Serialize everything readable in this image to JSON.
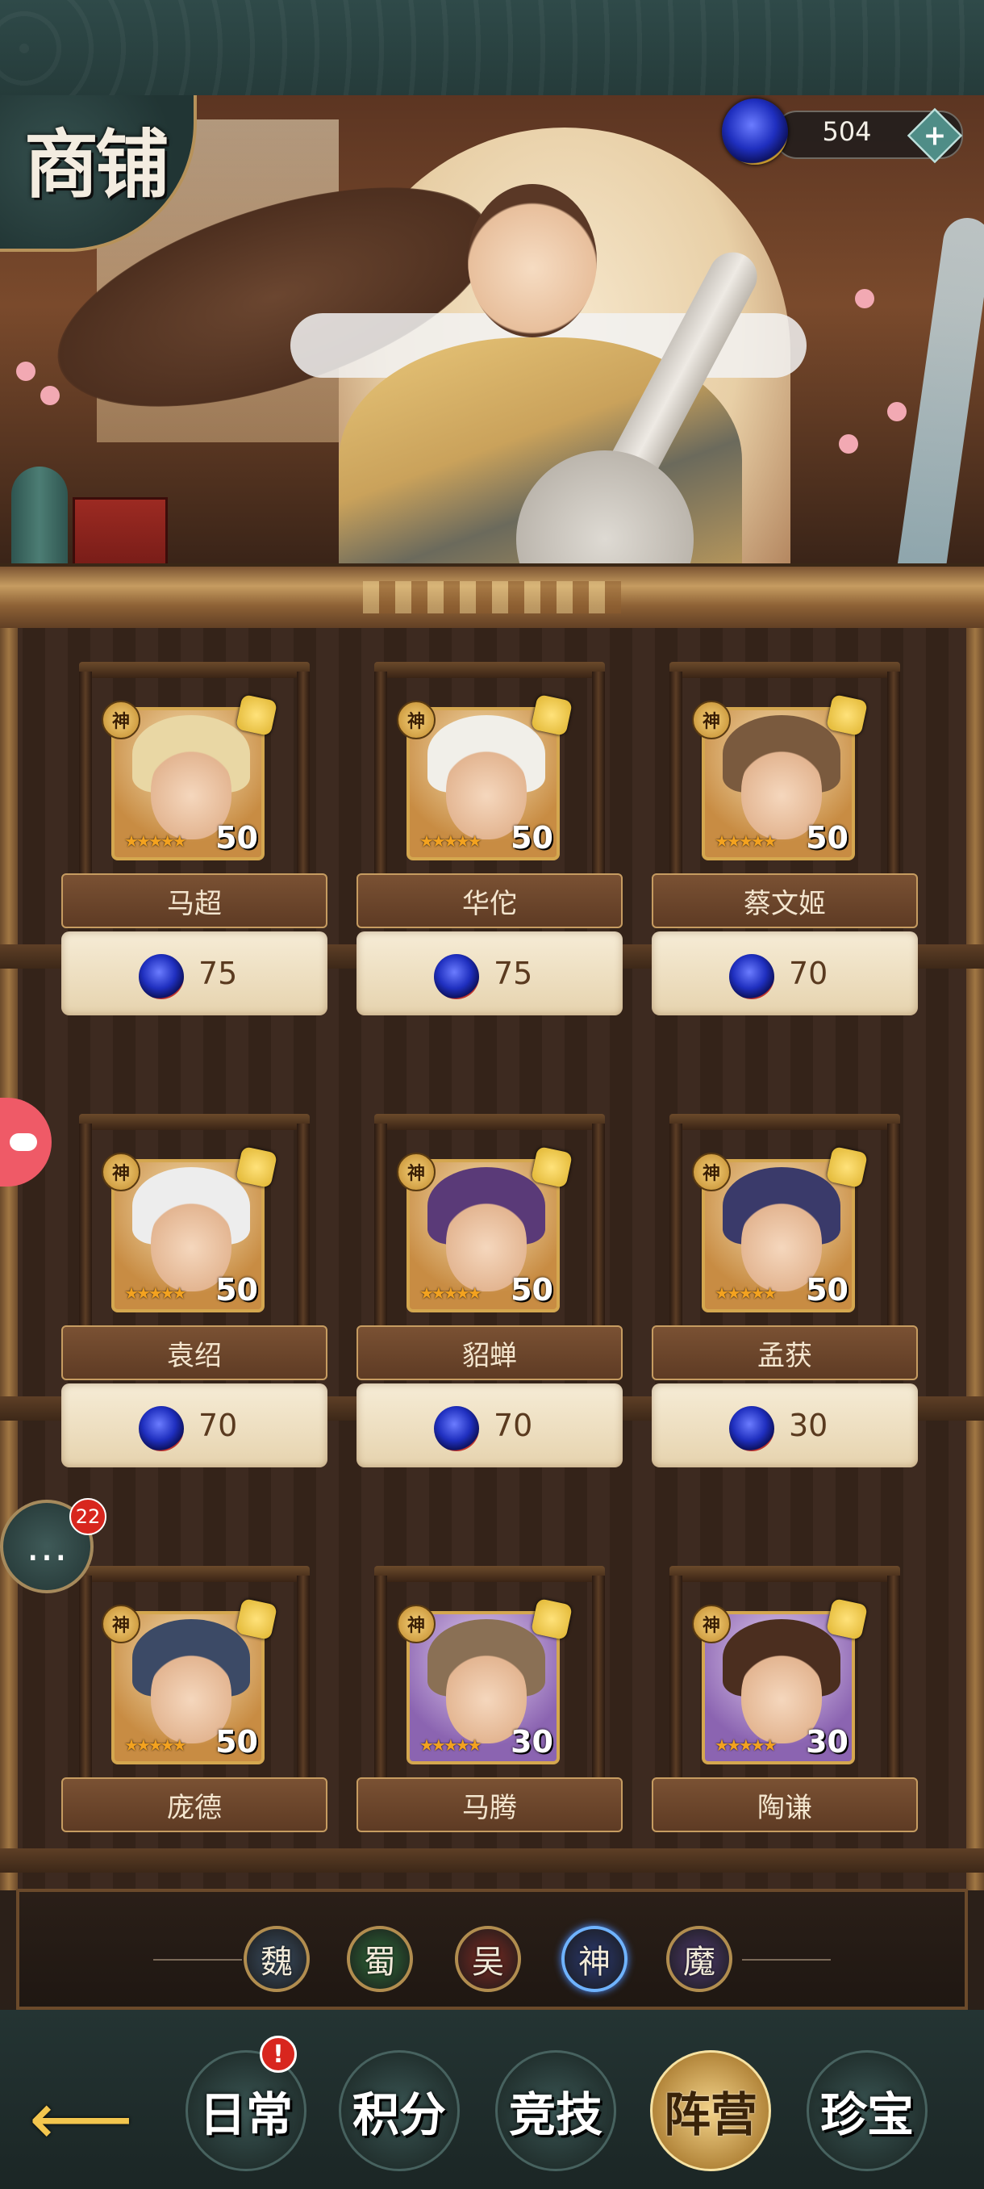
{
  "shop": {
    "title": "商铺",
    "currency_amount": "504",
    "add_currency_icon": "plus-icon"
  },
  "heroes": [
    {
      "name": "马超",
      "level": "50",
      "price": "75",
      "badge": "神",
      "color": "gold"
    },
    {
      "name": "华佗",
      "level": "50",
      "price": "75",
      "badge": "神",
      "color": "gold"
    },
    {
      "name": "蔡文姬",
      "level": "50",
      "price": "70",
      "badge": "神",
      "color": "gold"
    },
    {
      "name": "袁绍",
      "level": "50",
      "price": "70",
      "badge": "神",
      "color": "gold"
    },
    {
      "name": "貂蝉",
      "level": "50",
      "price": "70",
      "badge": "神",
      "color": "gold"
    },
    {
      "name": "孟获",
      "level": "50",
      "price": "30",
      "badge": "神",
      "color": "gold"
    },
    {
      "name": "庞德",
      "level": "50",
      "price": "",
      "badge": "神",
      "color": "gold"
    },
    {
      "name": "马腾",
      "level": "30",
      "price": "",
      "badge": "神",
      "color": "purple"
    },
    {
      "name": "陶谦",
      "level": "30",
      "price": "",
      "badge": "神",
      "color": "purple"
    }
  ],
  "factions": [
    {
      "label": "魏",
      "color": "#3c4f63"
    },
    {
      "label": "蜀",
      "color": "#2f6b39"
    },
    {
      "label": "吴",
      "color": "#7b2a22"
    },
    {
      "label": "神",
      "color": "#2b3a72",
      "selected": true
    },
    {
      "label": "魔",
      "color": "#4f3a6e"
    }
  ],
  "bottom_nav": {
    "back_icon": "arrow-left-icon",
    "alert": "!",
    "tabs": [
      {
        "label": "日常"
      },
      {
        "label": "积分"
      },
      {
        "label": "竞技"
      },
      {
        "label": "阵营",
        "active": true
      },
      {
        "label": "珍宝"
      }
    ]
  },
  "chat": {
    "count": "22",
    "icon": "chat-bubble-icon"
  },
  "side_icon": "game-controller-icon"
}
